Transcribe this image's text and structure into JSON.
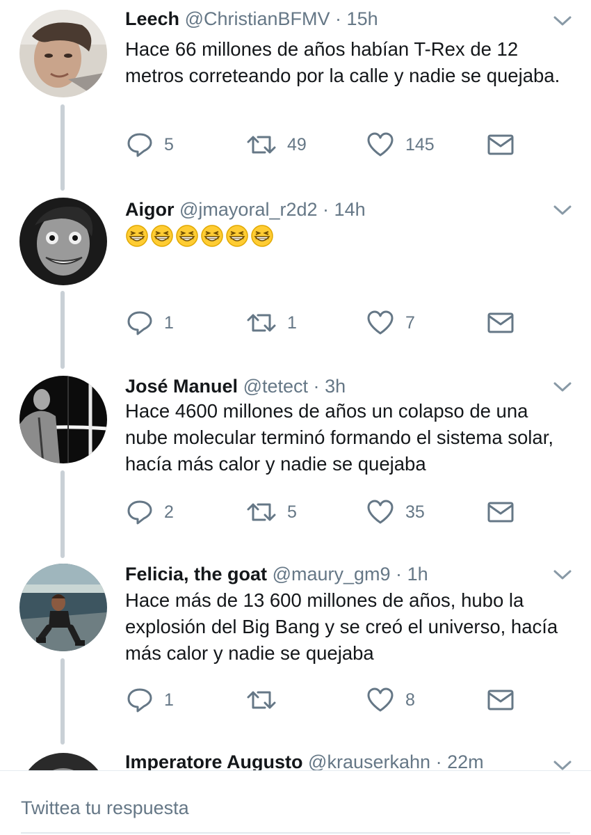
{
  "tweets": [
    {
      "name": "Leech",
      "handle": "@ChristianBFMV",
      "time": "15h",
      "text": "Hace 66 millones de años habían T-Rex de 12 metros correteando por la calle y nadie se quejaba.",
      "replies": "5",
      "retweets": "49",
      "likes": "145"
    },
    {
      "name": "Aigor",
      "handle": "@jmayoral_r2d2",
      "time": "14h",
      "emoji": [
        "grinning-squinting-face",
        "grinning-squinting-face",
        "grinning-squinting-face",
        "grinning-squinting-face",
        "grinning-squinting-face",
        "grinning-squinting-face"
      ],
      "replies": "1",
      "retweets": "1",
      "likes": "7"
    },
    {
      "name": "José Manuel",
      "handle": "@tetect",
      "time": "3h",
      "text": "Hace 4600 millones de años un colapso de una nube molecular terminó formando el sistema solar, hacía más calor y nadie se quejaba",
      "replies": "2",
      "retweets": "5",
      "likes": "35"
    },
    {
      "name": "Felicia, the goat",
      "handle": "@maury_gm9",
      "time": "1h",
      "text": "Hace más de 13 600 millones de años, hubo la explosión del Big Bang y se creó el universo, hacía más calor y nadie se quejaba",
      "replies": "1",
      "retweets": "",
      "likes": "8"
    },
    {
      "name": "Imperatore Augusto",
      "handle": "@krauserkahn",
      "time": "22m"
    }
  ],
  "reply_box": {
    "placeholder": "Twittea tu respuesta"
  },
  "colors": {
    "text": "#14171a",
    "secondary": "#657786",
    "thread_line": "#c9d0d6"
  }
}
